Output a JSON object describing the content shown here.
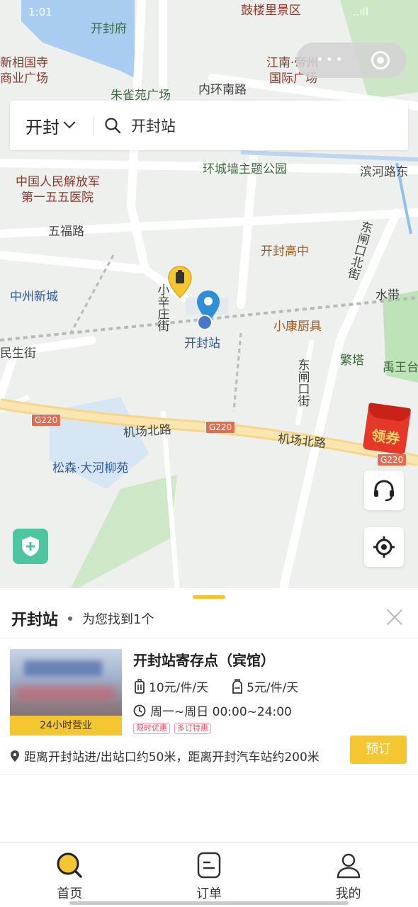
{
  "status_bar": {
    "time": "1:01",
    "signal": "..ıll"
  },
  "map": {
    "labels": {
      "kaifeng_fu": "开封府",
      "gulou": "鼓楼里景区",
      "xinxiangguosi": "新相国寺",
      "shangye": "商业广场",
      "zhuque": "朱雀苑广场",
      "jiangnan": "江南·帝州",
      "guoji": "国际广场",
      "neihuan": "内环南路",
      "huancheng": "环城墙主题公园",
      "binhe": "滨河路东",
      "hospital1": "中国人民解放军",
      "hospital2": "第一五五医院",
      "wufu": "五福路",
      "gaozhong": "开封高中",
      "zhouhekou": "东闸口北街",
      "zhongzhou": "中州新城",
      "xiaoxin": "小辛庄街",
      "station": "开封站",
      "xiaokang": "小康厨具",
      "shuidai": "水带",
      "minsheng": "民生街",
      "fanta": "繁塔",
      "yuwang": "禹王台",
      "dongzha": "东闸口街",
      "jichang1": "机场北路",
      "jichang2": "机场北路",
      "songsen": "松森·大河柳苑",
      "g220": "G220"
    }
  },
  "search": {
    "city": "开封",
    "query": "开封站"
  },
  "coupon_label": "领券",
  "panel": {
    "title": "开封站",
    "found_text": "为您找到1个"
  },
  "result": {
    "name": "开封站寄存点（宾馆）",
    "price_small": "10元/件/天",
    "price_large": "5元/件/天",
    "hours": "周一~周日 00:00~24:00",
    "promo1": "限时优惠",
    "promo2": "多订特惠",
    "open_tag": "24小时营业",
    "address": "距离开封站进/出站口约50米，距离开封汽车站约200米",
    "book_label": "预订"
  },
  "tabs": [
    {
      "label": "首页",
      "icon": "home-search-icon"
    },
    {
      "label": "订单",
      "icon": "order-icon"
    },
    {
      "label": "我的",
      "icon": "profile-icon"
    }
  ],
  "colors": {
    "accent": "#f4c632",
    "pin": "#2e8fd6",
    "coupon": "#e5382b",
    "shield": "#4fc4a0"
  }
}
